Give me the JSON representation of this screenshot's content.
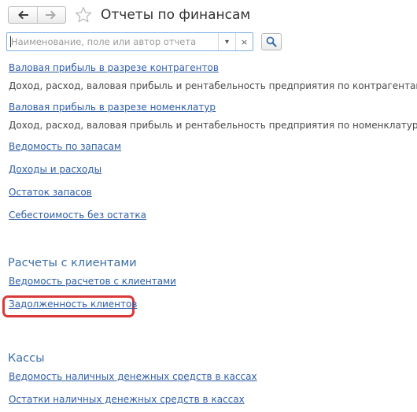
{
  "header": {
    "title": "Отчеты по финансам",
    "back_icon": "arrow-left-icon",
    "forward_icon": "arrow-right-icon",
    "favorite_icon": "star-icon"
  },
  "search": {
    "placeholder": "Наименование, поле или автор отчета",
    "value": "",
    "dropdown_glyph": "▾",
    "clear_glyph": "×",
    "button_icon": "magnifier-icon"
  },
  "groups": [
    {
      "title": "",
      "items": [
        {
          "label": "Валовая прибыль в разрезе контрагентов",
          "description": "Доход, расход, валовая прибыль и рентабельность предприятия по контрагентам."
        },
        {
          "label": "Валовая прибыль в разрезе номенклатур",
          "description": "Доход, расход, валовая прибыль и рентабельность предприятия по номенклатуре."
        },
        {
          "label": "Ведомость по запасам",
          "description": ""
        },
        {
          "label": "Доходы и расходы",
          "description": ""
        },
        {
          "label": "Остаток запасов",
          "description": ""
        },
        {
          "label": "Себестоимость без остатка",
          "description": ""
        }
      ]
    },
    {
      "title": "Расчеты с клиентами",
      "items": [
        {
          "label": "Ведомость расчетов с клиентами",
          "description": ""
        },
        {
          "label": "Задолженность клиентов",
          "description": "",
          "highlighted": true
        }
      ]
    },
    {
      "title": "Кассы",
      "items": [
        {
          "label": "Ведомость наличных денежных средств в кассах",
          "description": ""
        },
        {
          "label": "Остатки наличных денежных средств в кассах",
          "description": ""
        }
      ]
    }
  ],
  "colors": {
    "link": "#2f5ea8",
    "group_title": "#3d6fa7",
    "highlight": "#d93a3a",
    "search_border": "#7fb2e6"
  }
}
